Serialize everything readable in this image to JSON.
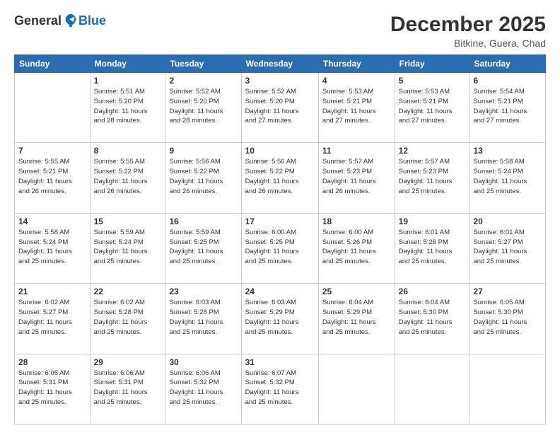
{
  "logo": {
    "general": "General",
    "blue": "Blue"
  },
  "header": {
    "month": "December 2025",
    "location": "Bitkine, Guera, Chad"
  },
  "weekdays": [
    "Sunday",
    "Monday",
    "Tuesday",
    "Wednesday",
    "Thursday",
    "Friday",
    "Saturday"
  ],
  "weeks": [
    [
      {
        "day": "",
        "sunrise": "",
        "sunset": "",
        "daylight": ""
      },
      {
        "day": "1",
        "sunrise": "Sunrise: 5:51 AM",
        "sunset": "Sunset: 5:20 PM",
        "daylight": "Daylight: 11 hours and 28 minutes."
      },
      {
        "day": "2",
        "sunrise": "Sunrise: 5:52 AM",
        "sunset": "Sunset: 5:20 PM",
        "daylight": "Daylight: 11 hours and 28 minutes."
      },
      {
        "day": "3",
        "sunrise": "Sunrise: 5:52 AM",
        "sunset": "Sunset: 5:20 PM",
        "daylight": "Daylight: 11 hours and 27 minutes."
      },
      {
        "day": "4",
        "sunrise": "Sunrise: 5:53 AM",
        "sunset": "Sunset: 5:21 PM",
        "daylight": "Daylight: 11 hours and 27 minutes."
      },
      {
        "day": "5",
        "sunrise": "Sunrise: 5:53 AM",
        "sunset": "Sunset: 5:21 PM",
        "daylight": "Daylight: 11 hours and 27 minutes."
      },
      {
        "day": "6",
        "sunrise": "Sunrise: 5:54 AM",
        "sunset": "Sunset: 5:21 PM",
        "daylight": "Daylight: 11 hours and 27 minutes."
      }
    ],
    [
      {
        "day": "7",
        "sunrise": "Sunrise: 5:55 AM",
        "sunset": "Sunset: 5:21 PM",
        "daylight": "Daylight: 11 hours and 26 minutes."
      },
      {
        "day": "8",
        "sunrise": "Sunrise: 5:55 AM",
        "sunset": "Sunset: 5:22 PM",
        "daylight": "Daylight: 11 hours and 26 minutes."
      },
      {
        "day": "9",
        "sunrise": "Sunrise: 5:56 AM",
        "sunset": "Sunset: 5:22 PM",
        "daylight": "Daylight: 11 hours and 26 minutes."
      },
      {
        "day": "10",
        "sunrise": "Sunrise: 5:56 AM",
        "sunset": "Sunset: 5:22 PM",
        "daylight": "Daylight: 11 hours and 26 minutes."
      },
      {
        "day": "11",
        "sunrise": "Sunrise: 5:57 AM",
        "sunset": "Sunset: 5:23 PM",
        "daylight": "Daylight: 11 hours and 26 minutes."
      },
      {
        "day": "12",
        "sunrise": "Sunrise: 5:57 AM",
        "sunset": "Sunset: 5:23 PM",
        "daylight": "Daylight: 11 hours and 25 minutes."
      },
      {
        "day": "13",
        "sunrise": "Sunrise: 5:58 AM",
        "sunset": "Sunset: 5:24 PM",
        "daylight": "Daylight: 11 hours and 25 minutes."
      }
    ],
    [
      {
        "day": "14",
        "sunrise": "Sunrise: 5:58 AM",
        "sunset": "Sunset: 5:24 PM",
        "daylight": "Daylight: 11 hours and 25 minutes."
      },
      {
        "day": "15",
        "sunrise": "Sunrise: 5:59 AM",
        "sunset": "Sunset: 5:24 PM",
        "daylight": "Daylight: 11 hours and 25 minutes."
      },
      {
        "day": "16",
        "sunrise": "Sunrise: 5:59 AM",
        "sunset": "Sunset: 5:25 PM",
        "daylight": "Daylight: 11 hours and 25 minutes."
      },
      {
        "day": "17",
        "sunrise": "Sunrise: 6:00 AM",
        "sunset": "Sunset: 5:25 PM",
        "daylight": "Daylight: 11 hours and 25 minutes."
      },
      {
        "day": "18",
        "sunrise": "Sunrise: 6:00 AM",
        "sunset": "Sunset: 5:26 PM",
        "daylight": "Daylight: 11 hours and 25 minutes."
      },
      {
        "day": "19",
        "sunrise": "Sunrise: 6:01 AM",
        "sunset": "Sunset: 5:26 PM",
        "daylight": "Daylight: 11 hours and 25 minutes."
      },
      {
        "day": "20",
        "sunrise": "Sunrise: 6:01 AM",
        "sunset": "Sunset: 5:27 PM",
        "daylight": "Daylight: 11 hours and 25 minutes."
      }
    ],
    [
      {
        "day": "21",
        "sunrise": "Sunrise: 6:02 AM",
        "sunset": "Sunset: 5:27 PM",
        "daylight": "Daylight: 11 hours and 25 minutes."
      },
      {
        "day": "22",
        "sunrise": "Sunrise: 6:02 AM",
        "sunset": "Sunset: 5:28 PM",
        "daylight": "Daylight: 11 hours and 25 minutes."
      },
      {
        "day": "23",
        "sunrise": "Sunrise: 6:03 AM",
        "sunset": "Sunset: 5:28 PM",
        "daylight": "Daylight: 11 hours and 25 minutes."
      },
      {
        "day": "24",
        "sunrise": "Sunrise: 6:03 AM",
        "sunset": "Sunset: 5:29 PM",
        "daylight": "Daylight: 11 hours and 25 minutes."
      },
      {
        "day": "25",
        "sunrise": "Sunrise: 6:04 AM",
        "sunset": "Sunset: 5:29 PM",
        "daylight": "Daylight: 11 hours and 25 minutes."
      },
      {
        "day": "26",
        "sunrise": "Sunrise: 6:04 AM",
        "sunset": "Sunset: 5:30 PM",
        "daylight": "Daylight: 11 hours and 25 minutes."
      },
      {
        "day": "27",
        "sunrise": "Sunrise: 6:05 AM",
        "sunset": "Sunset: 5:30 PM",
        "daylight": "Daylight: 11 hours and 25 minutes."
      }
    ],
    [
      {
        "day": "28",
        "sunrise": "Sunrise: 6:05 AM",
        "sunset": "Sunset: 5:31 PM",
        "daylight": "Daylight: 11 hours and 25 minutes."
      },
      {
        "day": "29",
        "sunrise": "Sunrise: 6:06 AM",
        "sunset": "Sunset: 5:31 PM",
        "daylight": "Daylight: 11 hours and 25 minutes."
      },
      {
        "day": "30",
        "sunrise": "Sunrise: 6:06 AM",
        "sunset": "Sunset: 5:32 PM",
        "daylight": "Daylight: 11 hours and 25 minutes."
      },
      {
        "day": "31",
        "sunrise": "Sunrise: 6:07 AM",
        "sunset": "Sunset: 5:32 PM",
        "daylight": "Daylight: 11 hours and 25 minutes."
      },
      {
        "day": "",
        "sunrise": "",
        "sunset": "",
        "daylight": ""
      },
      {
        "day": "",
        "sunrise": "",
        "sunset": "",
        "daylight": ""
      },
      {
        "day": "",
        "sunrise": "",
        "sunset": "",
        "daylight": ""
      }
    ]
  ]
}
